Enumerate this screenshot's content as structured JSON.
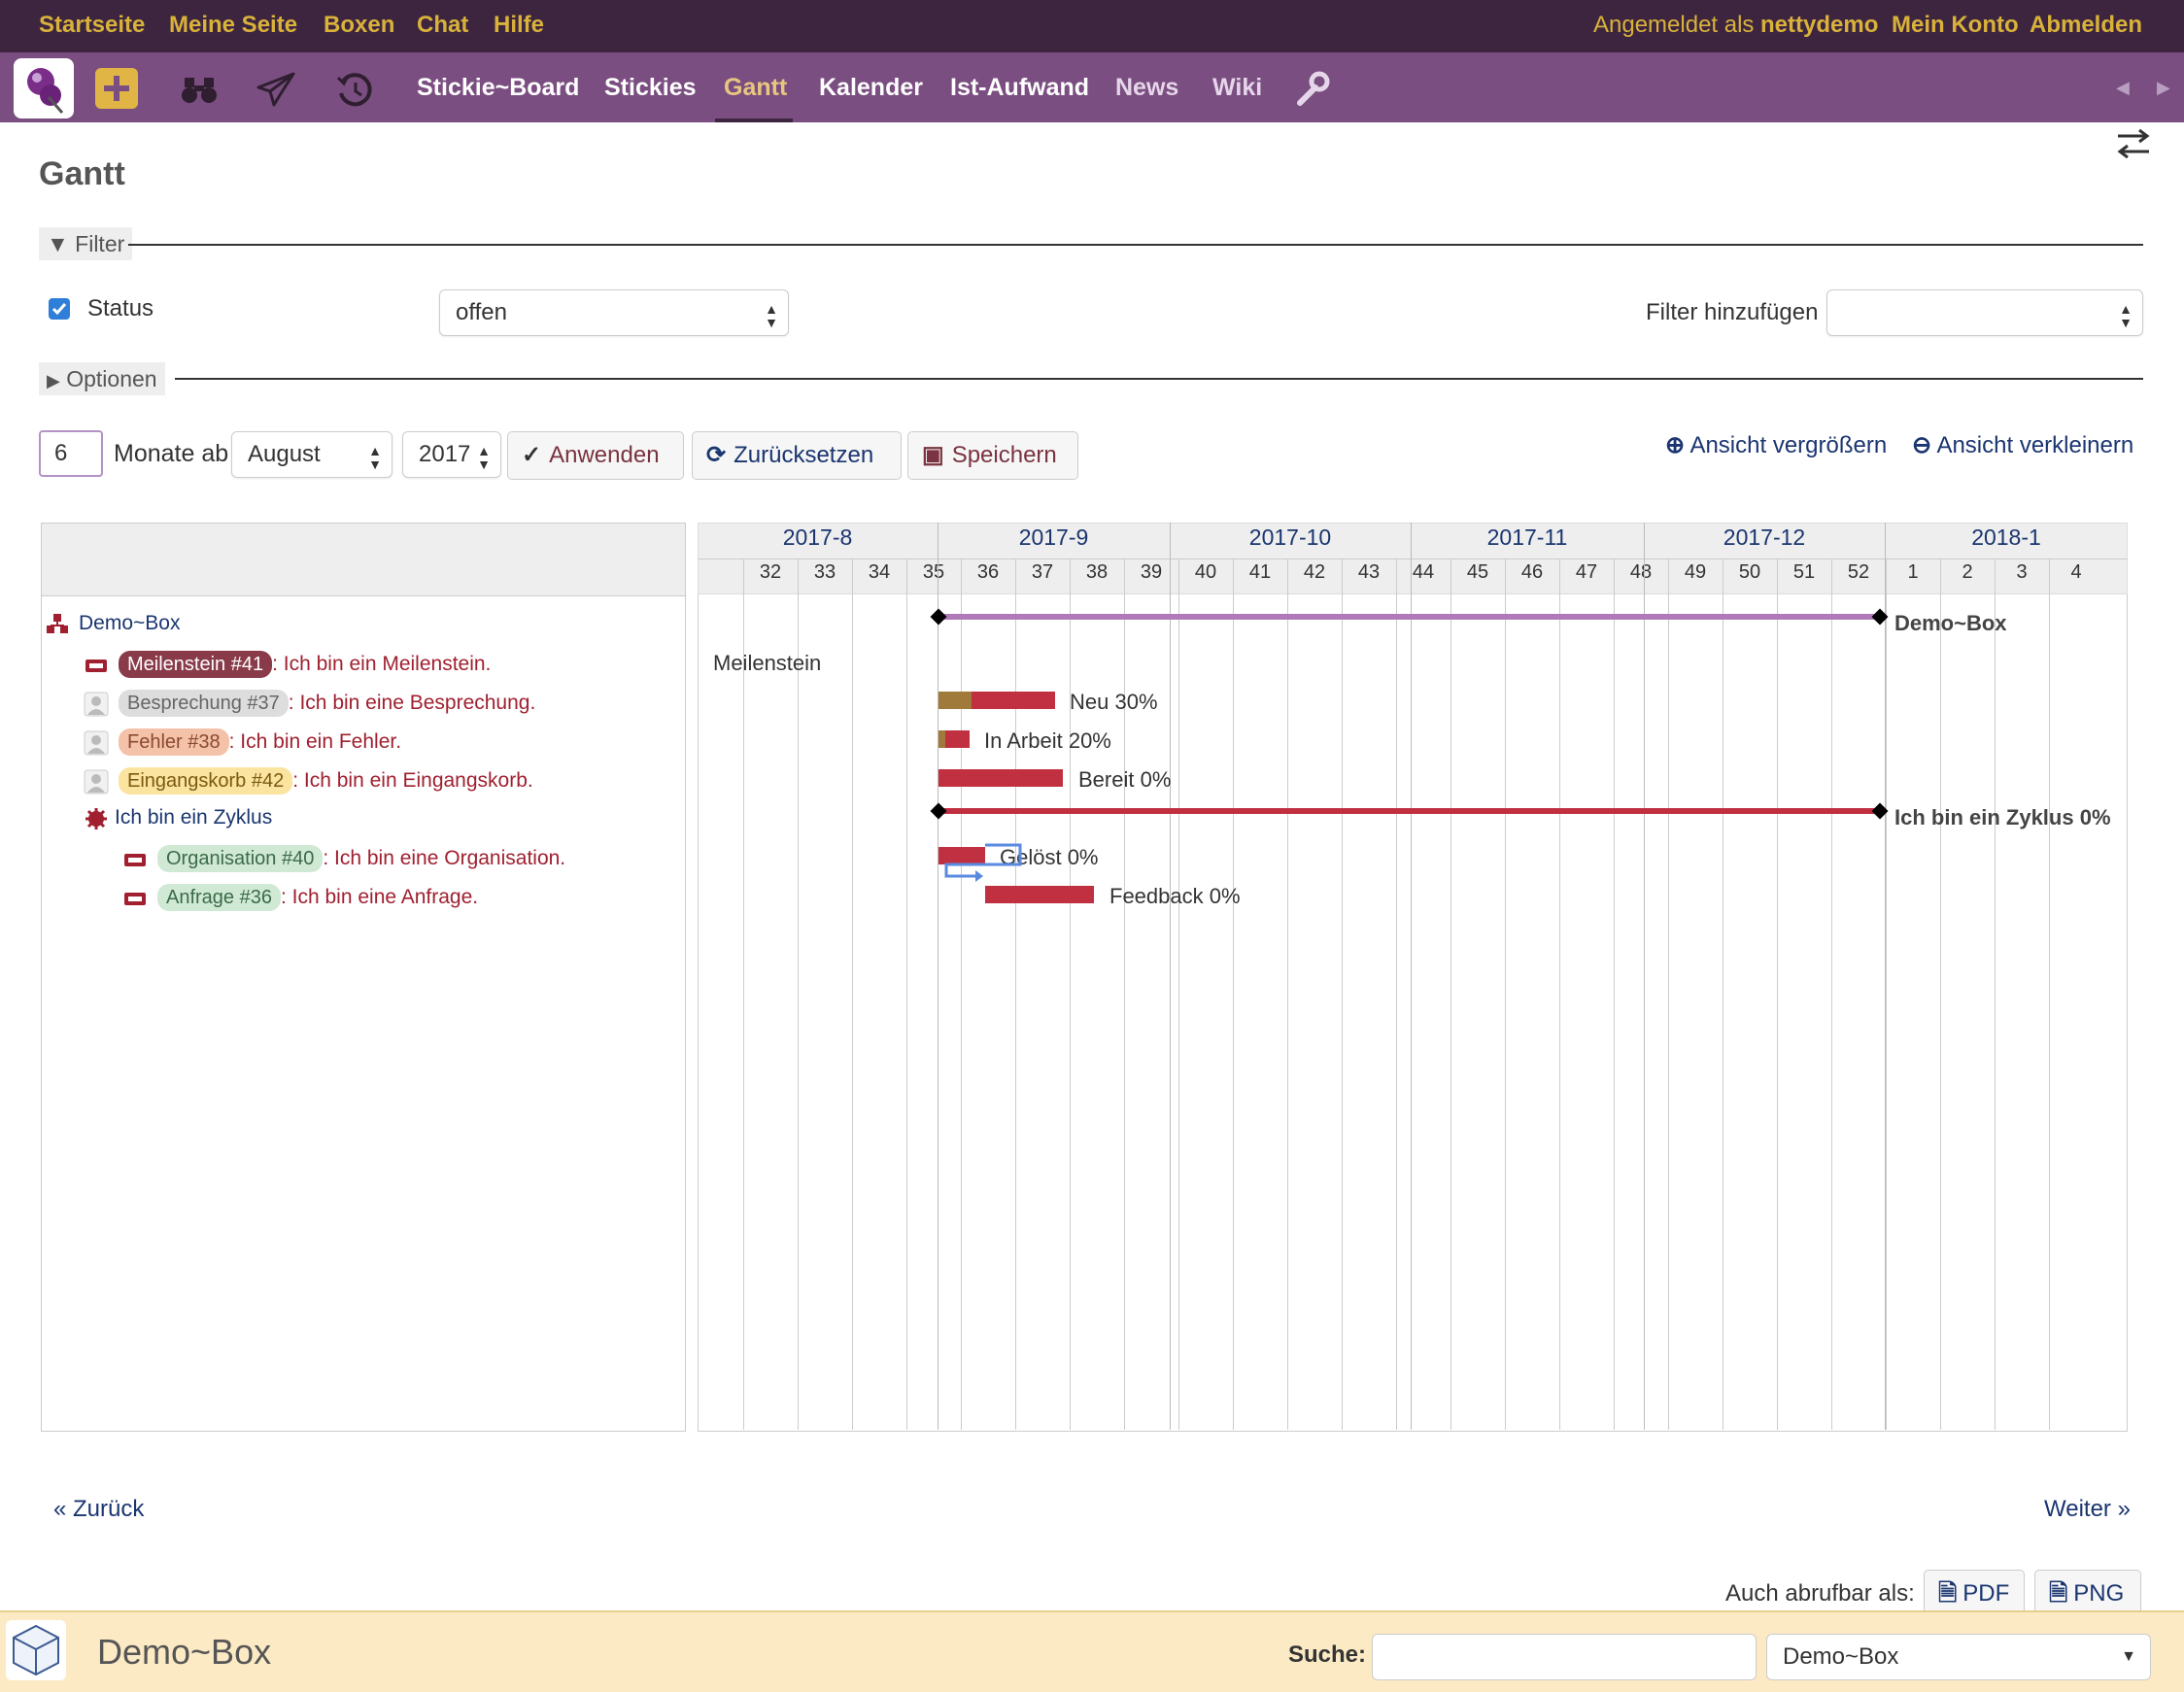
{
  "topbar": {
    "left_links": [
      "Startseite",
      "Meine Seite",
      "Boxen",
      "Chat",
      "Hilfe"
    ],
    "logged_in_prefix": "Angemeldet als",
    "username": "nettydemo",
    "account": "Mein Konto",
    "logout": "Abmelden"
  },
  "nav": {
    "tabs": [
      "Stickie~Board",
      "Stickies",
      "Gantt",
      "Kalender",
      "Ist-Aufwand",
      "News",
      "Wiki"
    ],
    "active": "Gantt"
  },
  "page": {
    "title": "Gantt"
  },
  "filter": {
    "legend": "Filter",
    "status_label": "Status",
    "status_value": "offen",
    "add_filter_label": "Filter hinzufügen",
    "add_filter_value": ""
  },
  "options": {
    "legend": "Optionen"
  },
  "controls": {
    "months": "6",
    "months_label": "Monate ab",
    "month": "August",
    "year": "2017",
    "apply": "Anwenden",
    "reset": "Zurücksetzen",
    "save": "Speichern",
    "zoom_in": "Ansicht vergrößern",
    "zoom_out": "Ansicht verkleinern"
  },
  "gantt": {
    "months": [
      "2017-8",
      "2017-9",
      "2017-10",
      "2017-11",
      "2017-12",
      "2018-1"
    ],
    "weeks": [
      "32",
      "33",
      "34",
      "35",
      "36",
      "37",
      "38",
      "39",
      "40",
      "41",
      "42",
      "43",
      "44",
      "45",
      "46",
      "47",
      "48",
      "49",
      "50",
      "51",
      "52",
      "1",
      "2",
      "3",
      "4"
    ],
    "project": "Demo~Box",
    "rows": [
      {
        "badge": "Meilenstein #41",
        "text": ": Ich bin ein Meilenstein.",
        "badge_bg": "#8a3b4a",
        "badge_fg": "#ffffff"
      },
      {
        "badge": "Besprechung #37",
        "text": ": Ich bin eine Besprechung.",
        "badge_bg": "#dddddd",
        "badge_fg": "#666666"
      },
      {
        "badge": "Fehler #38",
        "text": ": Ich bin ein Fehler.",
        "badge_bg": "#f4c2a8",
        "badge_fg": "#8a4a30"
      },
      {
        "badge": "Eingangskorb #42",
        "text": ": Ich bin ein Eingangskorb.",
        "badge_bg": "#fbe3a0",
        "badge_fg": "#7a5a10"
      }
    ],
    "version": "Ich bin ein Zyklus",
    "version_rows": [
      {
        "badge": "Organisation #40",
        "text": ": Ich bin eine Organisation.",
        "badge_bg": "#cfe9d4",
        "badge_fg": "#3c6a48"
      },
      {
        "badge": "Anfrage #36",
        "text": ": Ich bin eine Anfrage.",
        "badge_bg": "#cfe9d4",
        "badge_fg": "#3c6a48"
      }
    ],
    "bar_labels": {
      "project": "Demo~Box",
      "milestone": "Meilenstein",
      "besprechung": "Neu 30%",
      "fehler": "In Arbeit 20%",
      "eingangskorb": "Bereit 0%",
      "version": "Ich bin ein Zyklus 0%",
      "organisation": "Gelöst 0%",
      "anfrage": "Feedback 0%"
    }
  },
  "pagination": {
    "prev": "« Zurück",
    "next": "Weiter »"
  },
  "export": {
    "label": "Auch abrufbar als:",
    "pdf": "PDF",
    "png": "PNG"
  },
  "footer": {
    "project": "Demo~Box",
    "search_label": "Suche:",
    "search_value": "",
    "scope": "Demo~Box"
  }
}
